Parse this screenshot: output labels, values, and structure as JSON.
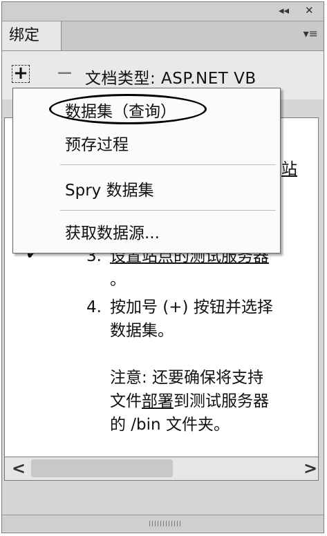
{
  "window": {
    "collapse_icon": "◂◂",
    "close_icon": "✕",
    "tab_label": "绑定",
    "tab_menu_icon": "▾≡"
  },
  "toolbar": {
    "add_label": "+",
    "remove_label": "−",
    "doc_type": "文档类型: ASP.NET VB"
  },
  "menu": {
    "items": [
      "数据集（查询）",
      "预存过程",
      "Spry 数据集",
      "获取数据源..."
    ]
  },
  "content": {
    "behind_char": "站",
    "step3_num": "3.",
    "step3_text": "设置站点的测试服务器",
    "step3_tail": "。",
    "step4_num": "4.",
    "step4_line1": "按加号 (+) 按钮并选择",
    "step4_line2": "数据集。",
    "note_line1": "注意: 还要确保将支持",
    "note_line2_a": "文件",
    "note_line2_b": "部署",
    "note_line2_c": "到测试服务器",
    "note_line3": "的 /bin 文件夹。",
    "check_icon": "✔"
  },
  "scrollbar": {
    "left_icon": "<",
    "right_icon": ">"
  }
}
